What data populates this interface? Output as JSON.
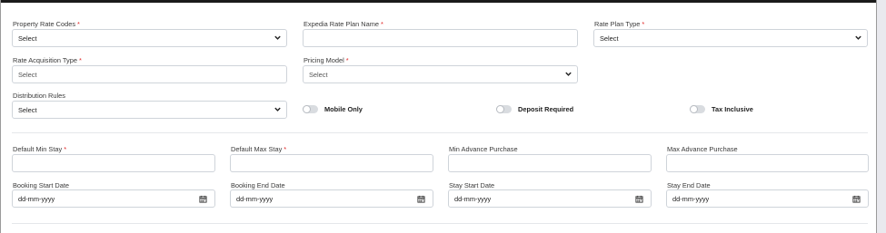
{
  "row1": {
    "property_rate_codes": {
      "label": "Property Rate Codes",
      "value": "Select"
    },
    "expedia_rate_plan_name": {
      "label": "Expedia Rate Plan Name",
      "value": ""
    },
    "rate_plan_type": {
      "label": "Rate Plan Type",
      "value": "Select"
    }
  },
  "row2": {
    "rate_acquisition_type": {
      "label": "Rate Acquisition Type",
      "value": "Select"
    },
    "pricing_model": {
      "label": "Pricing Model",
      "value": "Select"
    }
  },
  "row3": {
    "distribution_rules": {
      "label": "Distribution Rules",
      "value": "Select"
    },
    "mobile_only": {
      "label": "Mobile Only",
      "on": false
    },
    "deposit_required": {
      "label": "Deposit Required",
      "on": false
    },
    "tax_inclusive": {
      "label": "Tax Inclusive",
      "on": false
    }
  },
  "stay": {
    "default_min_stay": {
      "label": "Default Min Stay",
      "value": ""
    },
    "default_max_stay": {
      "label": "Default Max Stay",
      "value": ""
    },
    "min_advance_purchase": {
      "label": "Min Advance Purchase",
      "value": ""
    },
    "max_advance_purchase": {
      "label": "Max Advance Purchase",
      "value": ""
    }
  },
  "dates": {
    "booking_start_date": {
      "label": "Booking Start Date",
      "placeholder": "dd-mm-yyyy"
    },
    "booking_end_date": {
      "label": "Booking End Date",
      "placeholder": "dd-mm-yyyy"
    },
    "stay_start_date": {
      "label": "Stay Start Date",
      "placeholder": "dd-mm-yyyy"
    },
    "stay_end_date": {
      "label": "Stay End Date",
      "placeholder": "dd-mm-yyyy"
    }
  },
  "required_mark": "*",
  "icons": {
    "select": "chevron-down-icon",
    "date": "calendar-icon",
    "toggle": "toggle-switch"
  }
}
